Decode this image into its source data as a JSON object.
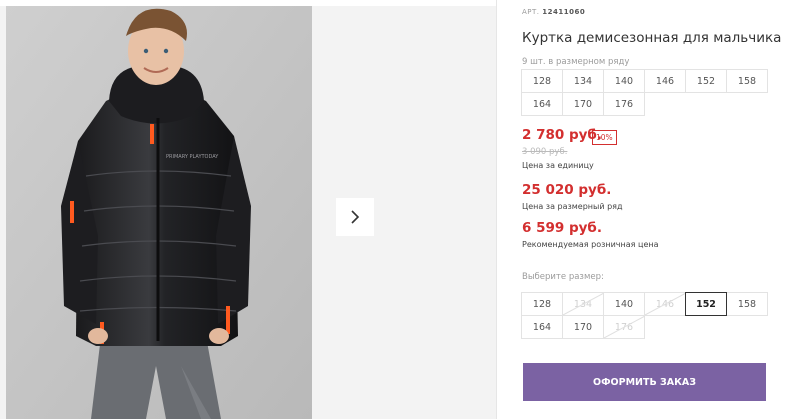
{
  "product": {
    "art_label": "АРТ.",
    "art_number": "12411060",
    "title": "Куртка демисезонная для мальчика"
  },
  "size_row": {
    "hint": "9 шт. в размерном ряду",
    "sizes": [
      "128",
      "134",
      "140",
      "146",
      "152",
      "158",
      "164",
      "170",
      "176"
    ]
  },
  "prices": {
    "unit_price": "2 780 руб.",
    "discount_badge": "10%",
    "old_price": "3 090 руб.",
    "unit_caption": "Цена за единицу",
    "row_price": "25 020 руб.",
    "row_caption": "Цена за размерный ряд",
    "retail_price": "6 599 руб.",
    "retail_caption": "Рекомендуемая розничная цена"
  },
  "size_select": {
    "label": "Выберите размер:",
    "options": [
      {
        "label": "128",
        "available": true,
        "selected": false
      },
      {
        "label": "134",
        "available": false,
        "selected": false
      },
      {
        "label": "140",
        "available": true,
        "selected": false
      },
      {
        "label": "146",
        "available": false,
        "selected": false
      },
      {
        "label": "152",
        "available": true,
        "selected": true
      },
      {
        "label": "158",
        "available": true,
        "selected": false
      },
      {
        "label": "164",
        "available": true,
        "selected": false
      },
      {
        "label": "170",
        "available": true,
        "selected": false
      },
      {
        "label": "176",
        "available": false,
        "selected": false
      }
    ]
  },
  "order_button": "ОФОРМИТЬ ЗАКАЗ",
  "gallery": {
    "next_icon": "chevron-right-icon",
    "jacket_print": "PRIMARY PLAYTODAY"
  },
  "colors": {
    "price_red": "#d32f2f",
    "button_purple": "#7b62a3"
  }
}
